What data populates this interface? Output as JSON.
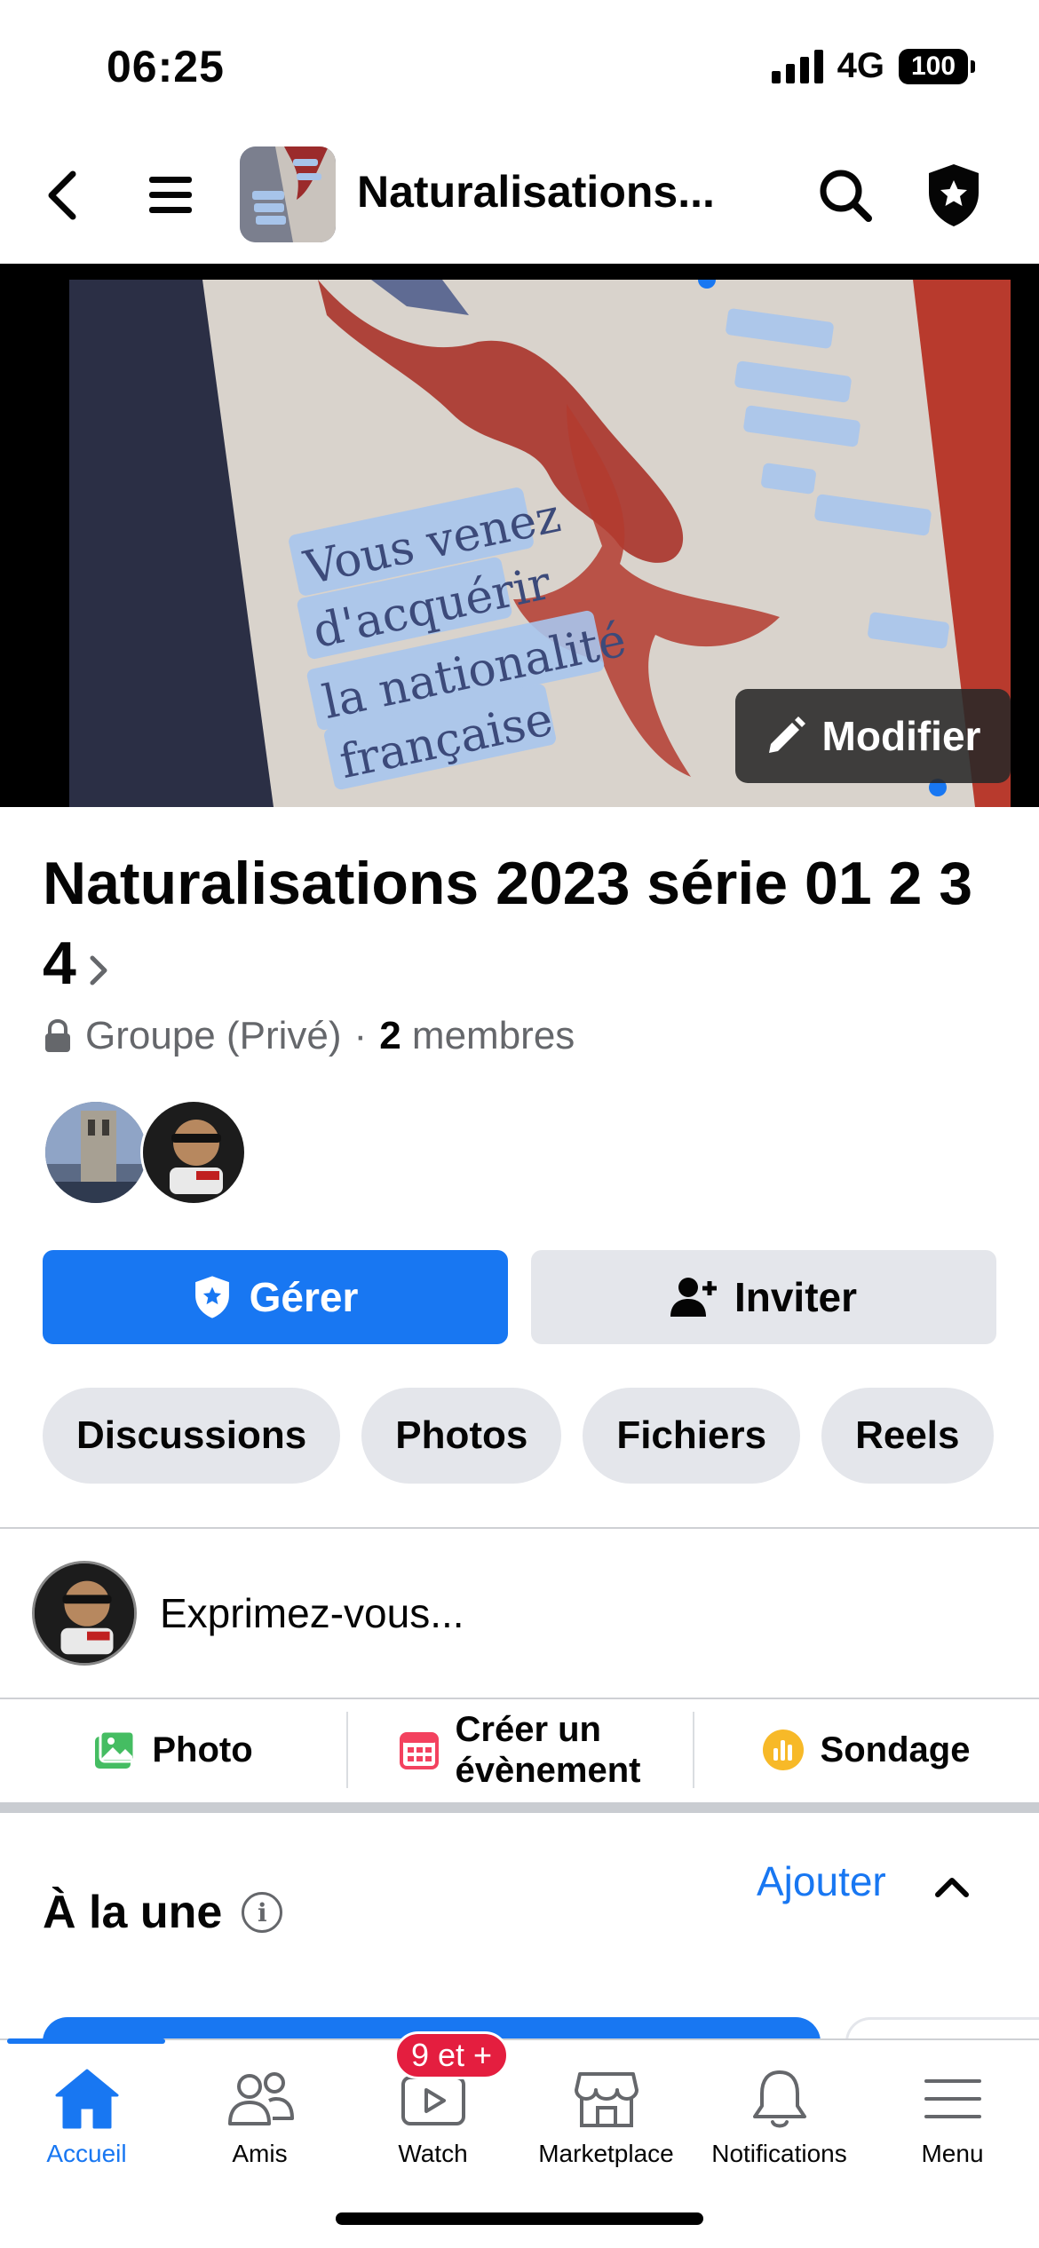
{
  "status_bar": {
    "time": "06:25",
    "network": "4G",
    "battery": "100"
  },
  "header": {
    "title": "Naturalisations..."
  },
  "cover": {
    "edit_label": "Modifier",
    "text_lines": [
      "Vous venez",
      "d'acquérir",
      "la nationalité",
      "française"
    ]
  },
  "group": {
    "name": "Naturalisations  2023 série 01 2 3 4",
    "privacy": "Groupe (Privé)",
    "separator": "·",
    "member_count": "2",
    "members_word": "membres"
  },
  "buttons": {
    "manage": "Gérer",
    "invite": "Inviter"
  },
  "tabs": [
    "Discussions",
    "Photos",
    "Fichiers",
    "Reels"
  ],
  "composer": {
    "placeholder": "Exprimez-vous..."
  },
  "actions": {
    "photo": "Photo",
    "event_line1": "Créer un",
    "event_line2": "évènement",
    "poll": "Sondage"
  },
  "featured": {
    "title": "À la une",
    "add": "Ajouter"
  },
  "bottom_nav": {
    "items": [
      "Accueil",
      "Amis",
      "Watch",
      "Marketplace",
      "Notifications",
      "Menu"
    ],
    "watch_badge": "9 et +",
    "active": "Accueil"
  },
  "colors": {
    "accent": "#1877f2",
    "badge": "#e41e3f",
    "chip_bg": "#e4e6eb",
    "photo_icon": "#45bd62",
    "event_icon": "#f3425f",
    "poll_icon": "#f7b928"
  },
  "icons": [
    "back-icon",
    "hamburger-icon",
    "search-icon",
    "admin-shield-icon",
    "pencil-icon",
    "lock-icon",
    "chevron-right-icon",
    "shield-star-icon",
    "add-person-icon",
    "photo-icon",
    "calendar-icon",
    "poll-icon",
    "info-icon",
    "chevron-up-icon",
    "home-icon",
    "friends-icon",
    "watch-icon",
    "marketplace-icon",
    "bell-icon",
    "menu-icon"
  ]
}
